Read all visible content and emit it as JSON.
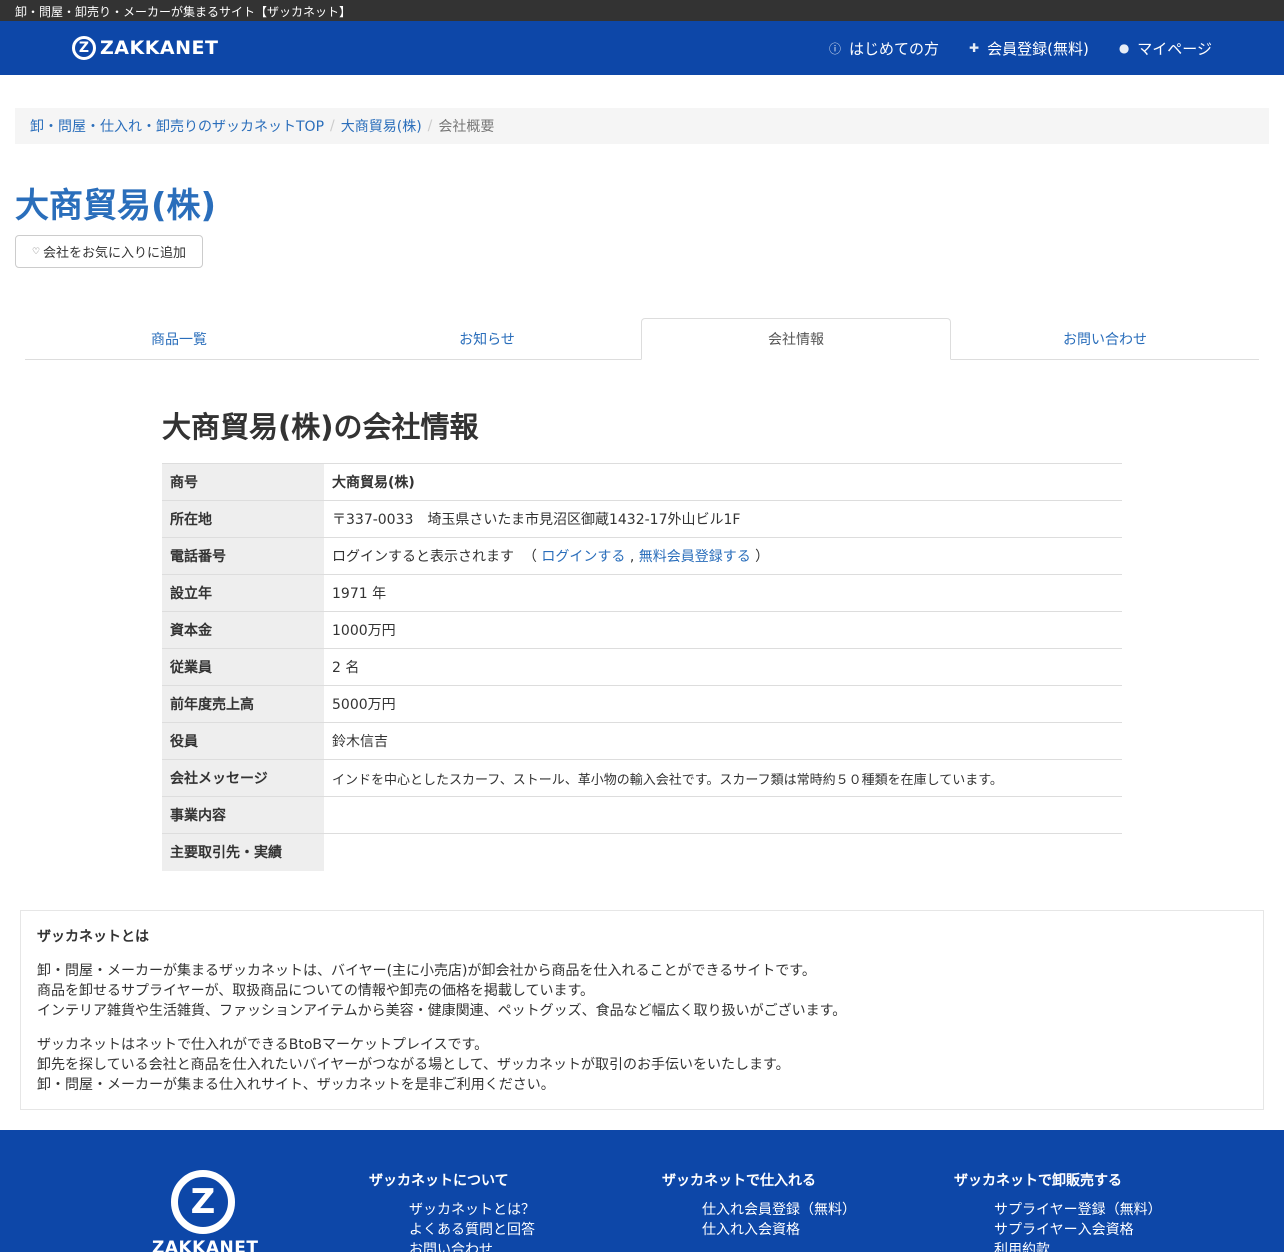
{
  "topbar": {
    "text": "卸・問屋・卸売り・メーカーが集まるサイト【ザッカネット】"
  },
  "header": {
    "logo_text": "ZAKKANET",
    "logo_mark": "Z",
    "nav": [
      {
        "label": "はじめての方",
        "icon": "info-icon"
      },
      {
        "label": "会員登録(無料)",
        "icon": "user-plus-icon"
      },
      {
        "label": "マイページ",
        "icon": "user-icon"
      }
    ]
  },
  "breadcrumb": {
    "items": [
      "卸・問屋・仕入れ・卸売りのザッカネットTOP",
      "大商貿易(株)"
    ],
    "current": "会社概要",
    "separator": "/"
  },
  "company": {
    "name": "大商貿易(株)",
    "favorite_label": "会社をお気に入りに追加"
  },
  "tabs": [
    {
      "label": "商品一覧",
      "active": false
    },
    {
      "label": "お知らせ",
      "active": false
    },
    {
      "label": "会社情報",
      "active": true
    },
    {
      "label": "お問い合わせ",
      "active": false
    }
  ],
  "info": {
    "title": "大商貿易(株)の会社情報",
    "rows": [
      {
        "label": "商号",
        "value": "大商貿易(株)"
      },
      {
        "label": "所在地",
        "value": "〒337-0033　埼玉県さいたま市見沼区御蔵1432-17外山ビル1F"
      },
      {
        "label": "電話番号",
        "value": "ログインすると表示されます",
        "login_link": "ログインする",
        "register_link": "無料会員登録する"
      },
      {
        "label": "設立年",
        "value": "1971 年"
      },
      {
        "label": "資本金",
        "value": "1000万円"
      },
      {
        "label": "従業員",
        "value": "2 名"
      },
      {
        "label": "前年度売上高",
        "value": "5000万円"
      },
      {
        "label": "役員",
        "value": "鈴木信吉"
      },
      {
        "label": "会社メッセージ",
        "value": "インドを中心としたスカーフ、ストール、革小物の輸入会社です。スカーフ類は常時約５０種類を在庫しています。"
      },
      {
        "label": "事業内容",
        "value": ""
      },
      {
        "label": "主要取引先・実績",
        "value": ""
      }
    ]
  },
  "about": {
    "title": "ザッカネットとは",
    "p1_l1": "卸・問屋・メーカーが集まるザッカネットは、バイヤー(主に小売店)が卸会社から商品を仕入れることができるサイトです。",
    "p1_l2": "商品を卸せるサプライヤーが、取扱商品についての情報や卸売の価格を掲載しています。",
    "p1_l3": "インテリア雑貨や生活雑貨、ファッションアイテムから美容・健康関連、ペットグッズ、食品など幅広く取り扱いがございます。",
    "p2_l1": "ザッカネットはネットで仕入れができるBtoBマーケットプレイスです。",
    "p2_l2": "卸先を探している会社と商品を仕入れたいバイヤーがつながる場として、ザッカネットが取引のお手伝いをいたします。",
    "p2_l3": "卸・問屋・メーカーが集まる仕入れサイト、ザッカネットを是非ご利用ください。"
  },
  "footer": {
    "logo_mark": "Z",
    "logo_text": "ZAKKANET",
    "columns": [
      {
        "title": "ザッカネットについて",
        "links": [
          "ザッカネットとは？",
          "よくある質問と回答",
          "お問い合わせ"
        ]
      },
      {
        "title": "ザッカネットで仕入れる",
        "links": [
          "仕入れ会員登録（無料）",
          "仕入れ入会資格"
        ]
      },
      {
        "title": "ザッカネットで卸販売する",
        "links": [
          "サプライヤー登録（無料）",
          "サプライヤー入会資格",
          "利用約款"
        ]
      }
    ]
  }
}
